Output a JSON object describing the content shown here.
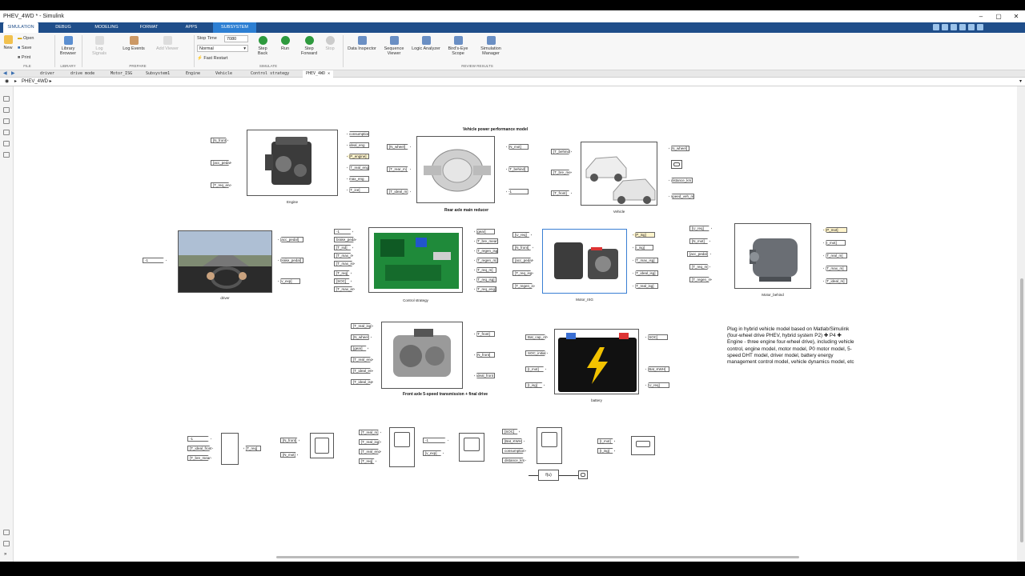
{
  "window": {
    "title": "PHEV_4WD * - Simulink"
  },
  "ribbon_tabs": [
    "SIMULATION",
    "DEBUG",
    "MODELING",
    "FORMAT",
    "APPS",
    "SUBSYSTEM BLOCK"
  ],
  "file": {
    "new": "New",
    "open": "Open",
    "save": "Save",
    "print": "Print",
    "section": "FILE"
  },
  "library": {
    "browser": "Library Browser",
    "section": "LIBRARY"
  },
  "prepare": {
    "log_signals": "Log Signals",
    "log_events": "Log Events",
    "add_viewer": "Add Viewer",
    "section": "PREPARE"
  },
  "simulate": {
    "stop_time_label": "Stop Time",
    "stop_time_value": "7080",
    "mode": "Normal",
    "fast_restart": "Fast Restart",
    "step_back": "Step Back",
    "run": "Run",
    "step_forward": "Step Forward",
    "stop": "Stop",
    "section": "SIMULATE"
  },
  "review": {
    "items": [
      "Data Inspector",
      "Sequence Viewer",
      "Logic Analyzer",
      "Bird's-Eye Scope",
      "Simulation Manager"
    ],
    "section": "REVIEW RESULTS"
  },
  "model_tabs": [
    "driver",
    "drive mode",
    "Motor_ISG",
    "Subsystem1",
    "Engine",
    "Vehicle",
    "Control strategy",
    "PHEV_4WD"
  ],
  "breadcrumb": "PHEV_4WD",
  "blocks": {
    "engine": {
      "label": "Engine",
      "in": [
        "[N_front]",
        "[acc_pedal]",
        "[T_req_eng]"
      ],
      "out": [
        "consumption",
        "ideal_eng",
        "[P_engine]",
        "[T_real_eng]",
        "max_eng",
        "[T_ice]"
      ]
    },
    "rear": {
      "title": "Vehicle power performance model",
      "label": "Rear axle main reducer",
      "in": [
        "[N_wheel]",
        "[T_rear_m]",
        "[T_ideal_m]"
      ],
      "out": [
        "[N_mot]",
        "[T_behind]",
        "-1"
      ]
    },
    "vehicle": {
      "label": "Vehicle",
      "in": [
        "[T_behind]",
        "[T_bre_mean]",
        "[T_front]"
      ],
      "out": [
        "[N_wheel]",
        "",
        "distance_km",
        "speed_veh_real"
      ]
    },
    "driver": {
      "label": "driver",
      "in": [
        "-1"
      ],
      "out": [
        "[acc_pedal]",
        "brake_pedal]",
        "[v_exp]"
      ]
    },
    "control": {
      "label": "Control strategy",
      "in": [
        "-1",
        "brake_pedal",
        "[T_isd]",
        "[T_max_m]",
        "[T_max_isg]",
        "[T_req]",
        "[SOC]",
        "[T_max_eng]"
      ],
      "out": [
        "[gear]",
        "[T_bre_mean]",
        "[T_regen_isg]",
        "[T_regen_m]",
        "[T_req_m]",
        "[T_req_isg]",
        "[T_req_eng]"
      ]
    },
    "isg": {
      "label": "Motor_ISG",
      "in": [
        "[U_req]",
        "[N_front]",
        "[acc_pedal]",
        "[T_req_isg]",
        "[T_regen_isg]"
      ],
      "out": [
        "[P_isg]",
        "[I_isg]",
        "[T_max_isg]",
        "[T_ideal_isg]",
        "[T_real_isg]"
      ]
    },
    "behind": {
      "label": "Motor_behind",
      "in": [
        "[U_req]",
        "[N_mot]",
        "[acc_pedal]",
        "[T_req_m]",
        "[T_regen_m]"
      ],
      "out": [
        "[P_mot]",
        "[I_mot]",
        "[T_real_m]",
        "[T_max_m]",
        "[T_ideal_m]"
      ]
    },
    "trans": {
      "label": "Front axle 5-speed transmission + final drive",
      "in": [
        "[T_real_isg]",
        "[N_wheel]",
        "[gear]",
        "[T_real_eng]",
        "[T_ideal_eng]",
        "[T_ideal_isg]"
      ],
      "out": [
        "[T_front]",
        "[N_front]",
        "ideal_front"
      ]
    },
    "battery": {
      "label": "battery",
      "in": [
        "Bat_cap_Ah",
        "SOC_initial",
        "[I_mot]",
        "[I_isg]"
      ],
      "out": [
        "[SOC]",
        "[Bat_KWH]",
        "[U_req]"
      ]
    }
  },
  "scopes": {
    "g1": {
      "in": [
        "-1",
        "[T_ideal_front]",
        "[T_bre_mean]"
      ],
      "out": "[T_req]"
    },
    "g2": {
      "in": [
        "[N_front]",
        "[N_mot]"
      ]
    },
    "g3": {
      "in": [
        "[T_real_m]",
        "[T_real_isg]",
        "[T_real_eng]",
        "[T_req]"
      ]
    },
    "g4": {
      "in": [
        "-1",
        "[v_exp]"
      ]
    },
    "g5": {
      "in": [
        "[SOC]",
        "[Bat_KWH]",
        "consumption",
        "distance_km"
      ],
      "fcn": "f(u)"
    },
    "g6": {
      "in": [
        "[I_mot]",
        "[I_isg]"
      ]
    }
  },
  "note": "Plug in hybrid vehicle model based on Matlab/Simulink (four-wheel drive PHEV, hybrid system P2) ✚ P4 ✚ Engine - three engine four-wheel drive), including vehicle control, engine model, motor model, P0 motor model, 5-speed DHT model, driver model, battery energy management control model, vehicle dynamics model, etc"
}
